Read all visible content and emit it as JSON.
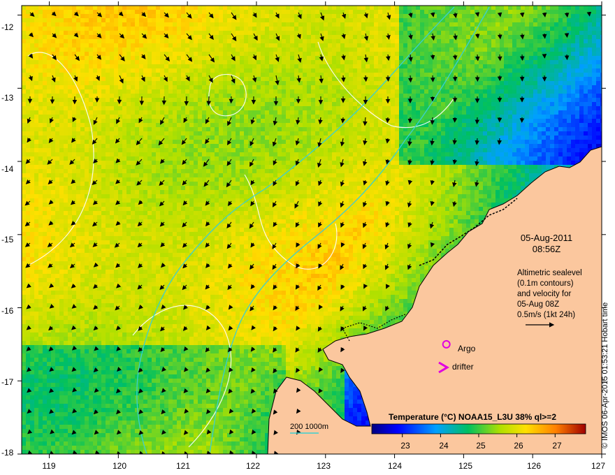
{
  "map": {
    "lon_ticks": [
      "119",
      "120",
      "121",
      "122",
      "123",
      "124",
      "125",
      "126",
      "127"
    ],
    "lat_ticks": [
      "-12",
      "-13",
      "-14",
      "-15",
      "-16",
      "-17",
      "-18"
    ],
    "lon_range": [
      118.6,
      127
    ],
    "lat_range": [
      -18,
      -11.87
    ],
    "date": "05-Aug-2011",
    "time": "08:56Z",
    "legend_lines": [
      "Altimetric sealevel",
      "(0.1m contours)",
      "and velocity for",
      "05-Aug 08Z",
      "0.5m/s (1kt 24h)"
    ],
    "credit": "© IMOS 06-Apr-2015 01:53:21 Hobart time",
    "argo_label": "Argo",
    "drifter_label": "drifter",
    "depth_label": "200  1000m",
    "colorbar": {
      "title": "Temperature (°C) NOAA15_L3U 38% ql>=2",
      "ticks": [
        "23",
        "24",
        "25",
        "26",
        "27"
      ],
      "range": [
        22.2,
        27.8
      ]
    },
    "argo_position": [
      124.75,
      -16.5
    ],
    "drifter_position": [
      124.7,
      -16.8
    ],
    "colors": {
      "land": "#fbc79e",
      "coast": "#000000",
      "argo": "#e000e0",
      "isobath": "#3ad0d0",
      "contour": "#ffffff"
    }
  }
}
